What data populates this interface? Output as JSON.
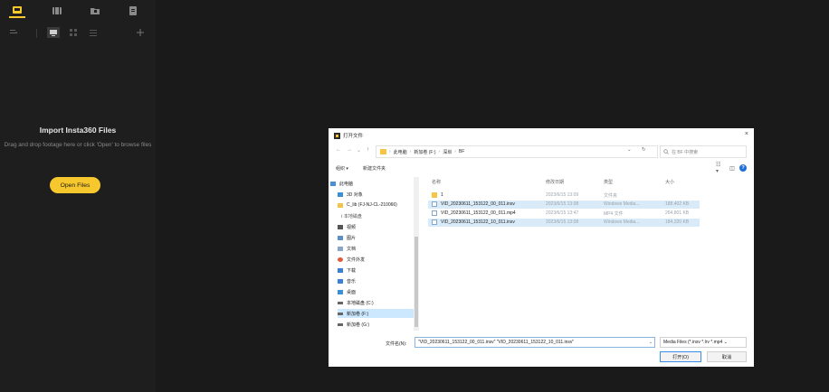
{
  "colors": {
    "accent": "#f7c82d",
    "panel": "#1e1e1e",
    "background": "#1a1a1a",
    "selection": "#cce8ff"
  },
  "left_panel": {
    "top_tabs": [
      {
        "icon": "media-folder-icon",
        "active": true
      },
      {
        "icon": "film-icon",
        "active": false
      },
      {
        "icon": "project-folder-icon",
        "active": false
      },
      {
        "icon": "document-icon",
        "active": false
      }
    ],
    "tools": {
      "filter_icon": "filter-icon",
      "grid_icon": "grid-view-icon",
      "tiles_icon": "tile-view-icon",
      "list_icon": "list-view-icon",
      "add_icon": "plus-icon"
    },
    "import_title": "Import Insta360 Files",
    "import_desc": "Drag and drop footage here or click 'Open' to browse files",
    "open_button": "Open Files"
  },
  "dialog": {
    "title": "打开文件",
    "close": "×",
    "nav": {
      "back": "←",
      "forward": "→",
      "dropdown": "⌄",
      "up": "↑"
    },
    "breadcrumb": [
      "此电脑",
      "›",
      "新加卷 (F:)",
      "›",
      "深圳",
      "›",
      "BF"
    ],
    "address_dropdown": "⌄",
    "refresh": "↻",
    "search_placeholder": "在 BF 中搜索",
    "toolbar": {
      "organize": "组织 ▾",
      "new_folder": "新建文件夹",
      "view_icon": "☷ ▾",
      "pane_icon": "◫",
      "help_icon": "?"
    },
    "tree": [
      {
        "label": "此电脑",
        "icon": "computer-icon",
        "color": "#4a90d9",
        "selected": false
      },
      {
        "label": "3D 对象",
        "icon": "3d-objects-icon",
        "color": "#3b8fd6",
        "selected": false
      },
      {
        "label": "C_lib (FJ-NJ-CL-210066)",
        "icon": "network-folder-icon",
        "color": "#f3c24c",
        "selected": false
      },
      {
        "label": "Ⅰ 本地磁盘",
        "icon": "",
        "color": "",
        "selected": false
      },
      {
        "label": "视频",
        "icon": "video-icon",
        "color": "#555555",
        "selected": false
      },
      {
        "label": "图片",
        "icon": "pictures-icon",
        "color": "#5a8fc9",
        "selected": false
      },
      {
        "label": "文档",
        "icon": "documents-icon",
        "color": "#8aa6c6",
        "selected": false
      },
      {
        "label": "文件外发",
        "icon": "share-icon",
        "color": "#e25a3a",
        "selected": false
      },
      {
        "label": "下载",
        "icon": "download-icon",
        "color": "#3b7fd6",
        "selected": false
      },
      {
        "label": "音乐",
        "icon": "music-icon",
        "color": "#3b7fd6",
        "selected": false
      },
      {
        "label": "桌面",
        "icon": "desktop-icon",
        "color": "#3b8fd6",
        "selected": false
      },
      {
        "label": "本地磁盘 (C:)",
        "icon": "drive-icon",
        "color": "#666666",
        "selected": false
      },
      {
        "label": "新加卷 (F:)",
        "icon": "drive-icon",
        "color": "#666666",
        "selected": true
      },
      {
        "label": "新加卷 (G:)",
        "icon": "drive-icon",
        "color": "#666666",
        "selected": false
      }
    ],
    "columns": {
      "name": "名称",
      "date": "修改日期",
      "type": "类型",
      "size": "大小"
    },
    "files": [
      {
        "name": "1",
        "date": "2023/6/15 13:09",
        "type": "文件夹",
        "size": "",
        "icon": "folder-icon",
        "selected": false
      },
      {
        "name": "VID_20230611_153122_00_011.insv",
        "date": "2023/6/15 13:08",
        "type": "Windows Media...",
        "size": "188,402 KB",
        "icon": "media-file-icon",
        "selected": true
      },
      {
        "name": "VID_20230611_153122_00_011.mp4",
        "date": "2023/6/15 13:47",
        "type": "MP4 文件",
        "size": "264,801 KB",
        "icon": "media-file-icon",
        "selected": false
      },
      {
        "name": "VID_20230611_153122_10_011.insv",
        "date": "2023/6/15 13:08",
        "type": "Windows Media...",
        "size": "184,320 KB",
        "icon": "media-file-icon",
        "selected": true
      }
    ],
    "filename_label": "文件名(N):",
    "filename_value": "\"VID_20230611_153122_00_011.insv\" \"VID_20230611_153122_10_011.insv\"",
    "filename_dropdown": "⌄",
    "filter_value": "Media Files (*.insv *.lrv *.mp4 ⌄",
    "open_button": "打开(O)",
    "cancel_button": "取消"
  }
}
